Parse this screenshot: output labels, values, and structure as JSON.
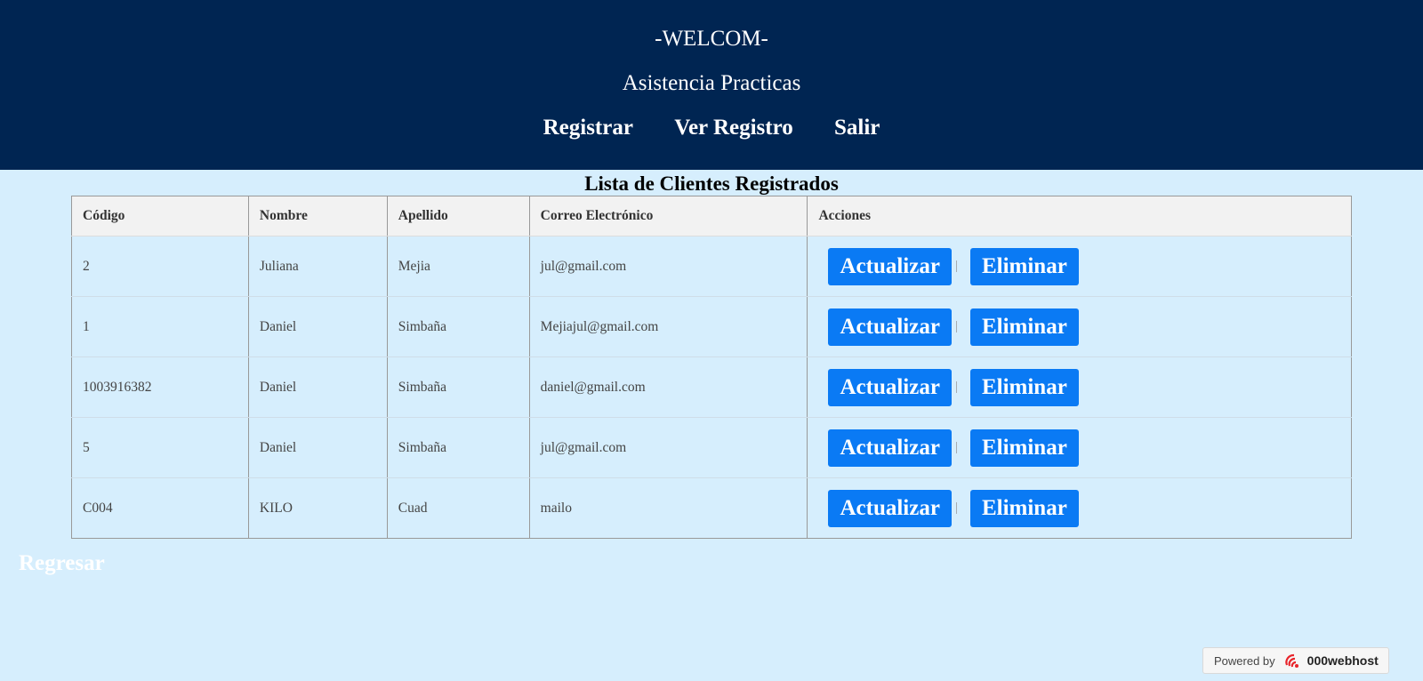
{
  "header": {
    "welcome": "-WELCOM-",
    "subtitle": "Asistencia Practicas",
    "nav": [
      "Registrar",
      "Ver Registro",
      "Salir"
    ]
  },
  "list_title": "Lista de Clientes Registrados",
  "table": {
    "headers": [
      "Código",
      "Nombre",
      "Apellido",
      "Correo Electrónico",
      "Acciones"
    ],
    "rows": [
      {
        "codigo": "2",
        "nombre": "Juliana",
        "apellido": "Mejia",
        "correo": "jul@gmail.com"
      },
      {
        "codigo": "1",
        "nombre": "Daniel",
        "apellido": "Simbaña",
        "correo": "Mejiajul@gmail.com"
      },
      {
        "codigo": "1003916382",
        "nombre": "Daniel",
        "apellido": "Simbaña",
        "correo": "daniel@gmail.com"
      },
      {
        "codigo": "5",
        "nombre": "Daniel",
        "apellido": "Simbaña",
        "correo": "jul@gmail.com"
      },
      {
        "codigo": "C004",
        "nombre": "KILO",
        "apellido": "Cuad",
        "correo": "mailo"
      }
    ],
    "update_label": "Actualizar",
    "separator": "|",
    "delete_label": "Eliminar"
  },
  "back_link": "Regresar",
  "footer": {
    "powered_by": "Powered by",
    "brand": "000webhost",
    "brand_icon": "000webhost-logo-icon"
  },
  "colors": {
    "header_bg": "#002552",
    "page_bg": "#d6eefd",
    "button_bg": "#0a7af4"
  }
}
